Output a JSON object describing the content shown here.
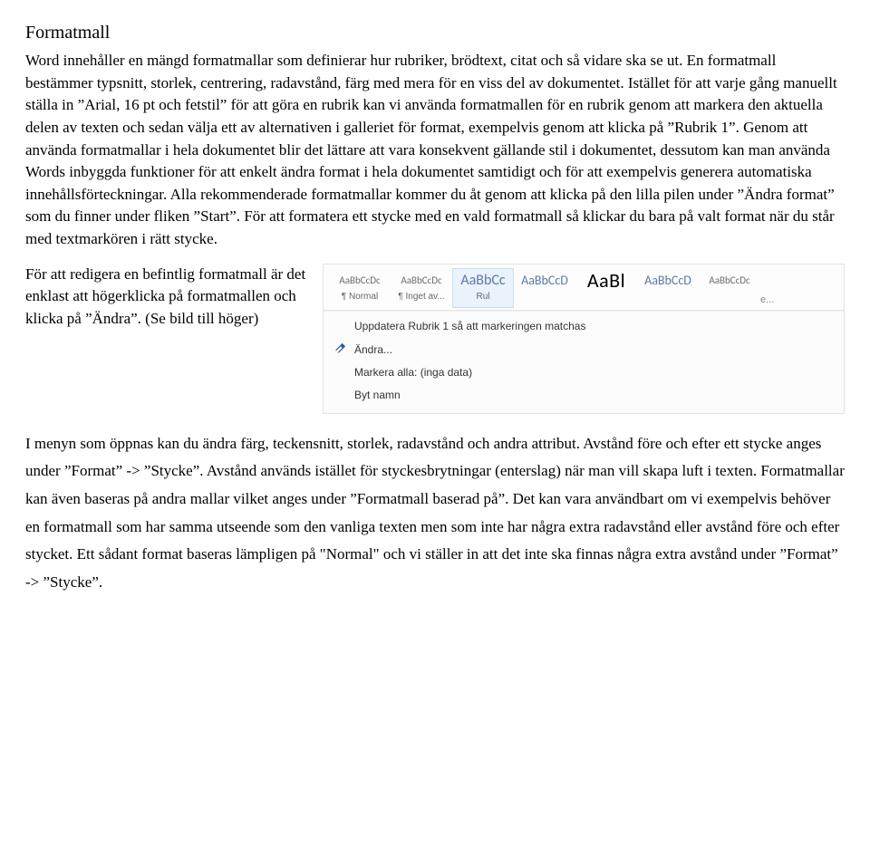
{
  "heading": "Formatmall",
  "para1": "Word innehåller en mängd formatmallar som definierar hur rubriker, brödtext, citat och så vidare ska se ut. En formatmall bestämmer typsnitt, storlek, centrering, radavstånd, färg med mera för en viss del av dokumentet. Istället för att varje gång manuellt ställa in ”Arial, 16 pt och fetstil” för att göra en rubrik kan vi använda formatmallen för en rubrik genom att markera den aktuella delen av texten och sedan välja ett av alternativen i galleriet för format, exempelvis genom att klicka på ”Rubrik 1”. Genom att använda formatmallar i hela dokumentet blir det lättare att vara konsekvent gällande stil i dokumentet, dessutom kan man använda Words inbyggda funktioner för att enkelt ändra format i hela dokumentet samtidigt och för att exempelvis generera automatiska innehållsförteckningar. Alla rekommenderade formatmallar kommer du åt genom att klicka på den lilla pilen under ”Ändra format” som du finner under fliken ”Start”. För att formatera ett stycke med en vald formatmall så klickar du bara på valt format när du står med textmarkören i rätt stycke.",
  "para_left": "För att redigera en befintlig formatmall är det enklast att högerklicka på formatmallen och klicka på ”Ändra”. (Se bild till höger)",
  "para3": "I menyn som öppnas kan du ändra färg, teckensnitt, storlek, radavstånd och andra attribut. Avstånd före och efter ett stycke anges under ”Format” -> ”Stycke”. Avstånd används istället för styckesbrytningar (enterslag) när man vill skapa luft i texten. Formatmallar kan även baseras på andra mallar vilket anges under ”Formatmall baserad på”. Det kan vara användbart om vi exempelvis behöver en formatmall som har samma utseende som den vanliga texten men som inte har några extra radavstånd eller avstånd före och efter stycket. Ett sådant format baseras lämpligen på \"Normal\" och vi ställer in att det inte ska finnas några extra avstånd under ”Format” -> ”Stycke”.",
  "gallery": {
    "sample_text_small": "AaBbCcDc",
    "sample_text_med": "AaBbCc",
    "sample_text_med2": "AaBbCcD",
    "sample_text_big": "AaBl",
    "tiles": [
      {
        "label": "¶ Normal"
      },
      {
        "label": "¶ Inget av..."
      },
      {
        "label": "Rul"
      },
      {
        "label": ""
      },
      {
        "label": ""
      },
      {
        "label": ""
      },
      {
        "label": ""
      }
    ],
    "more": "e..."
  },
  "context_menu": {
    "update": "Uppdatera Rubrik 1 så att markeringen matchas",
    "modify": "Ändra...",
    "select_all": "Markera alla: (inga data)",
    "rename": "Byt namn"
  }
}
